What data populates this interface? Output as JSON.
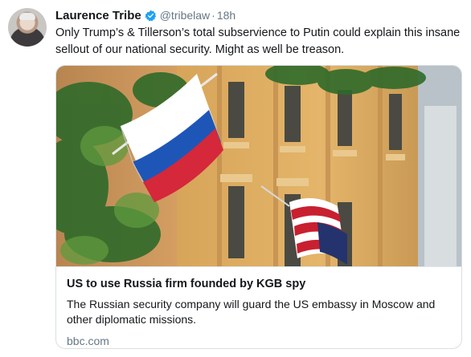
{
  "tweet": {
    "author_name": "Laurence Tribe",
    "handle": "@tribelaw",
    "separator": "·",
    "time": "18h",
    "text": "Only Trump’s & Tillerson’s total subservience to Putin could explain this insane sellout of our national security. Might as well be treason."
  },
  "card": {
    "title": "US to use Russia firm founded by KGB spy",
    "description": "The Russian security company will guard the US embassy in Moscow and other diplomatic missions.",
    "domain": "bbc.com"
  },
  "colors": {
    "verified": "#1da1f2",
    "secondary_text": "#657786",
    "border": "#d9dfe3"
  },
  "icons": {
    "verified": "verified-badge-icon"
  }
}
